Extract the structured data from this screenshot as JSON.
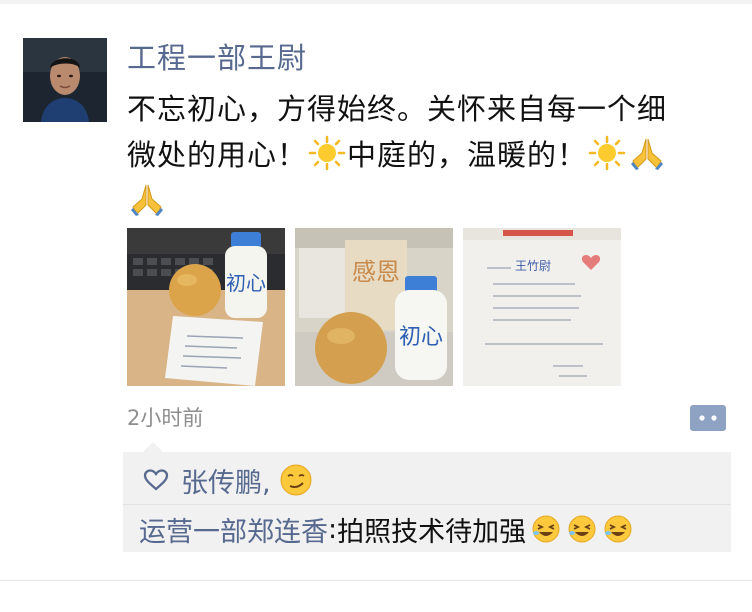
{
  "post": {
    "author": "工程一部王尉",
    "content_line1": "不忘初心，方得始终。关怀来自每一个细",
    "content_line2a": "微处的用心！",
    "content_line2b": "中庭的，温暖的！",
    "timestamp": "2小时前"
  },
  "photos": [
    {
      "bottle_label": "初心"
    },
    {
      "bottle_label": "初心",
      "card_label": "感恩"
    },
    {
      "note_label": "王竹尉"
    }
  ],
  "likes": {
    "names": "张传鹏,"
  },
  "comments": [
    {
      "author": "运营一部郑连香",
      "separator": ": ",
      "text": "拍照技术待加强"
    }
  ],
  "icons": [
    "sun-icon",
    "folded-hands-icon",
    "heart-icon",
    "smirk-emoji-icon",
    "rofl-emoji-icon",
    "comment-dots-icon"
  ],
  "colors": {
    "name_blue": "#57698f",
    "panel_bg": "#f1f1f1",
    "timestamp_gray": "#8e8e8e",
    "accent_button": "#8ea3c4"
  }
}
